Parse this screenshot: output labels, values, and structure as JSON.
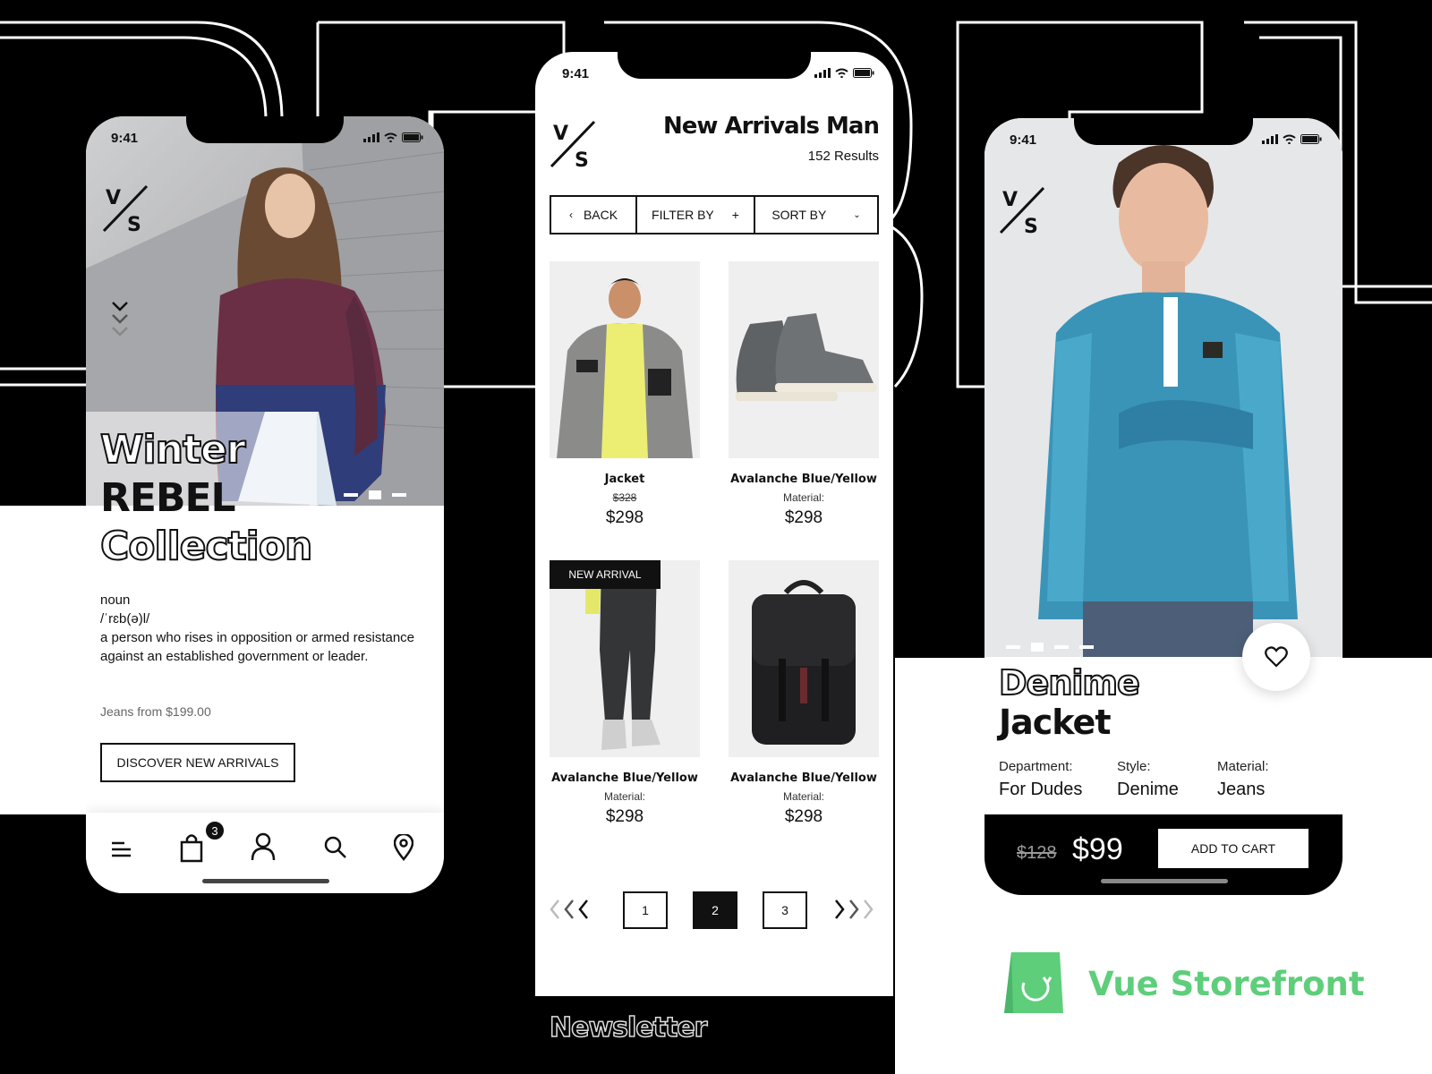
{
  "status_time": "9:41",
  "brand_logo": {
    "top": "V",
    "bottom": "S"
  },
  "left_phone": {
    "title_line1": "Winter",
    "title_line2": "REBEL",
    "title_line3": "Collection",
    "word_type": "noun",
    "phonetic": "/ˈrɛb(ə)l/",
    "definition": "a person who rises in opposition or armed resistance against an established government or leader.",
    "price_hint": "Jeans from $199.00",
    "cta_label": "DISCOVER NEW ARRIVALS",
    "cart_badge": "3",
    "nav_icons": [
      "menu-icon",
      "shopping-bag-icon",
      "user-icon",
      "search-icon",
      "location-pin-icon"
    ]
  },
  "middle_phone": {
    "title": "New Arrivals Man",
    "results": "152 Results",
    "back_label": "BACK",
    "filter_label": "FILTER BY",
    "sort_label": "SORT BY",
    "products": [
      {
        "name": "Jacket",
        "old_price": "$328",
        "price": "$298"
      },
      {
        "name": "Avalanche Blue/Yellow",
        "material": "Material:",
        "price": "$298"
      },
      {
        "name": "Avalanche Blue/Yellow",
        "material": "Material:",
        "price": "$298",
        "badge": "NEW ARRIVAL"
      },
      {
        "name": "Avalanche Blue/Yellow",
        "material": "Material:",
        "price": "$298"
      }
    ],
    "pagination": [
      "1",
      "2",
      "3"
    ],
    "current_page": "2"
  },
  "right_phone": {
    "title_line1": "Denime",
    "title_line2": "Jacket",
    "details": [
      {
        "label": "Department:",
        "value": "For Dudes"
      },
      {
        "label": "Style:",
        "value": "Denime"
      },
      {
        "label": "Material:",
        "value": "Jeans"
      }
    ],
    "old_price": "$128",
    "price": "$99",
    "add_to_cart": "ADD TO CART"
  },
  "newsletter_label": "Newsletter",
  "vue_brand": "Vue Storefront",
  "colors": {
    "accent_green": "#5ECE7B",
    "black": "#000000",
    "white": "#FFFFFF"
  }
}
